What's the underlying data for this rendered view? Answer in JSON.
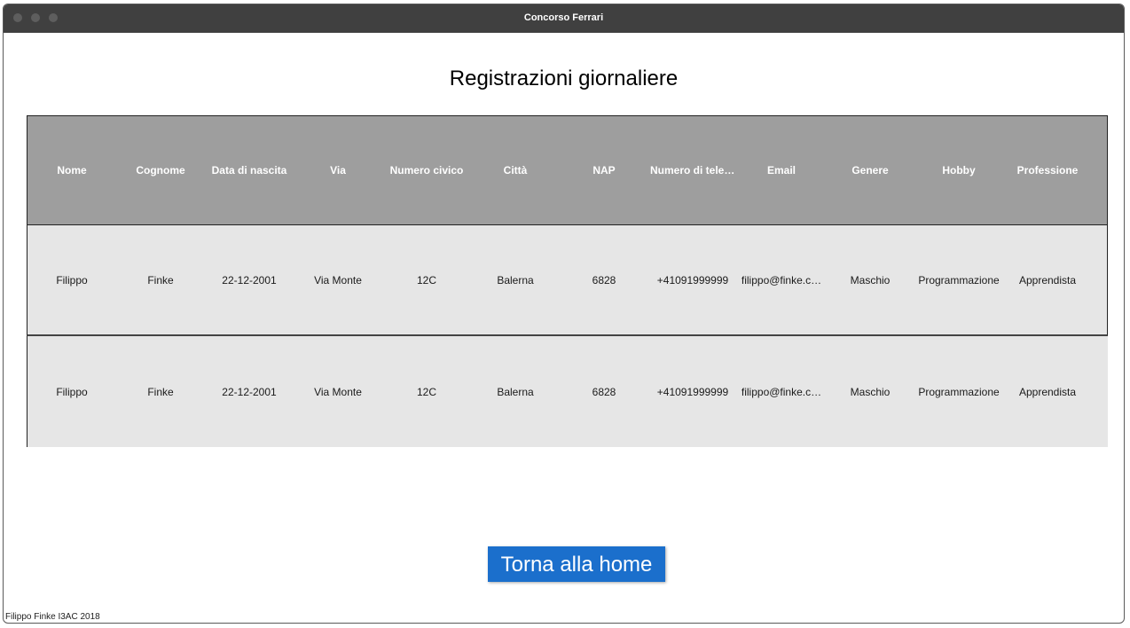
{
  "window": {
    "title": "Concorso Ferrari"
  },
  "page": {
    "title": "Registrazioni giornaliere"
  },
  "table": {
    "columns": [
      "Nome",
      "Cognome",
      "Data di nascita",
      "Via",
      "Numero civico",
      "Città",
      "NAP",
      "Numero di telef…",
      "Email",
      "Genere",
      "Hobby",
      "Professione"
    ],
    "rows": [
      [
        "Filippo",
        "Finke",
        "22-12-2001",
        "Via Monte",
        "12C",
        "Balerna",
        "6828",
        "+41091999999",
        "filippo@finke.c…",
        "Maschio",
        "Programmazione",
        "Apprendista"
      ],
      [
        "Filippo",
        "Finke",
        "22-12-2001",
        "Via Monte",
        "12C",
        "Balerna",
        "6828",
        "+41091999999",
        "filippo@finke.c…",
        "Maschio",
        "Programmazione",
        "Apprendista"
      ]
    ]
  },
  "actions": {
    "home_label": "Torna alla home"
  },
  "footer": {
    "text": "Filippo Finke I3AC 2018"
  },
  "colors": {
    "titlebar": "#404040",
    "header_bg": "#9e9e9e",
    "row_bg": "#e6e6e6",
    "button_bg": "#1b6fcc"
  }
}
